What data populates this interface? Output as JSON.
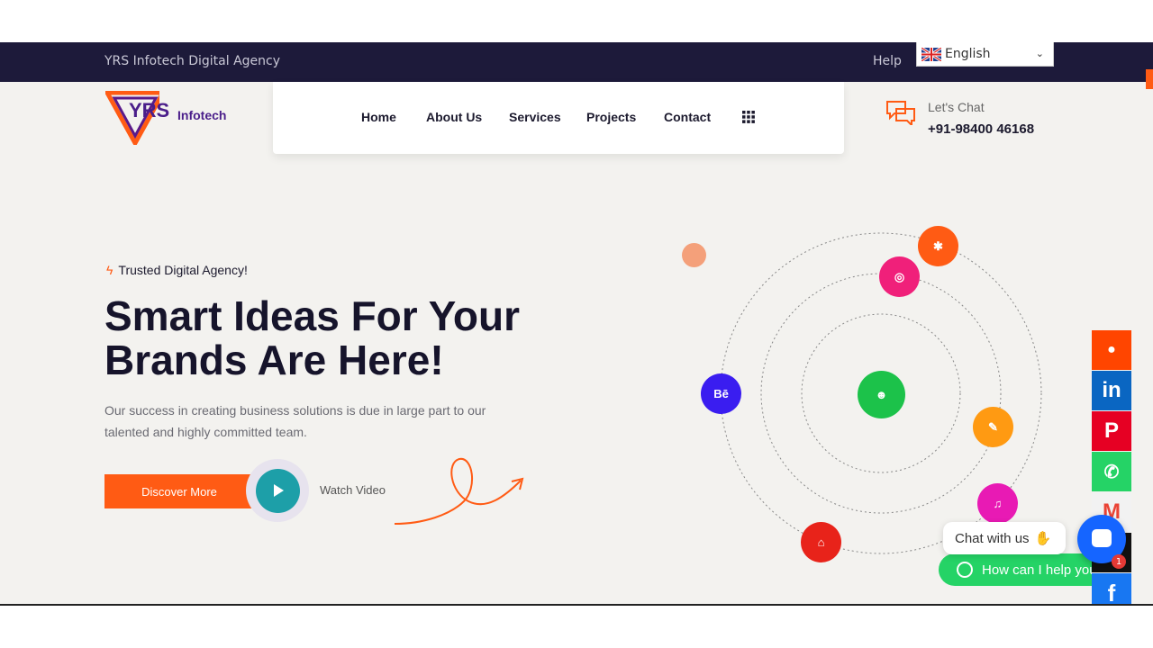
{
  "topbar": {
    "agency": "YRS Infotech Digital Agency",
    "help": "Help",
    "language": "English"
  },
  "logo": {
    "main": "YRS",
    "sub": "Infotech"
  },
  "nav": {
    "items": [
      "Home",
      "About Us",
      "Services",
      "Projects",
      "Contact"
    ],
    "grid_icon": "grid-icon"
  },
  "contact": {
    "label": "Let's Chat",
    "phone": "+91-98400 46168",
    "icon": "chat-bubbles-icon"
  },
  "hero": {
    "tagline": "Trusted Digital Agency!",
    "headline_line1": "Smart Ideas For Your",
    "headline_line2": "Brands Are Here!",
    "description": "Our success in creating business solutions is due in large part to our talented and highly committed team.",
    "discover": "Discover More",
    "watch": "Watch Video"
  },
  "orbit_icons": [
    "puzzle-icon",
    "dribbble-icon",
    "behance-icon",
    "android-icon",
    "pen-tool-icon",
    "music-icon",
    "vector-icon"
  ],
  "social": [
    "reddit-icon",
    "linkedin-icon",
    "pinterest-icon",
    "whatsapp-icon",
    "gmail-icon",
    "x-icon",
    "facebook-icon"
  ],
  "chat": {
    "prompt": "Chat with us",
    "badge": "1",
    "whatsapp_prompt": "How can I help you?"
  },
  "colors": {
    "accent": "#ff5b14",
    "topbar": "#1d1a3a",
    "teal": "#1d9fa8",
    "whatsapp": "#25d366"
  }
}
